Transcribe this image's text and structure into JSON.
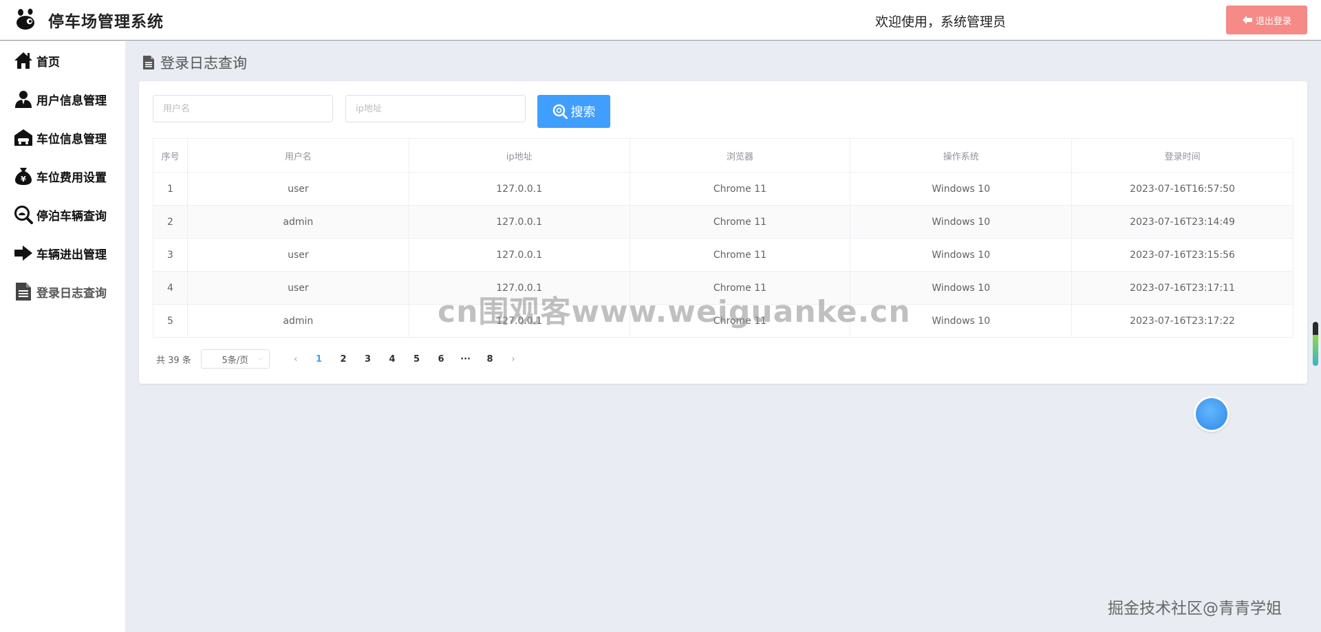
{
  "header": {
    "app_title": "停车场管理系统",
    "welcome_text": "欢迎使用，系统管理员",
    "logout_label": "退出登录"
  },
  "sidebar": {
    "items": [
      {
        "label": "首页",
        "icon": "home-icon"
      },
      {
        "label": "用户信息管理",
        "icon": "user-icon"
      },
      {
        "label": "车位信息管理",
        "icon": "garage-icon"
      },
      {
        "label": "车位费用设置",
        "icon": "money-bag-icon"
      },
      {
        "label": "停泊车辆查询",
        "icon": "search-car-icon"
      },
      {
        "label": "车辆进出管理",
        "icon": "arrow-right-icon"
      },
      {
        "label": "登录日志查询",
        "icon": "document-icon",
        "active": true
      }
    ]
  },
  "main": {
    "page_title": "登录日志查询",
    "search": {
      "username_placeholder": "用户名",
      "ip_placeholder": "ip地址",
      "search_label": "搜索"
    },
    "table": {
      "columns": [
        "序号",
        "用户名",
        "ip地址",
        "浏览器",
        "操作系统",
        "登录时间"
      ],
      "rows": [
        [
          "1",
          "user",
          "127.0.0.1",
          "Chrome 11",
          "Windows 10",
          "2023-07-16T16:57:50"
        ],
        [
          "2",
          "admin",
          "127.0.0.1",
          "Chrome 11",
          "Windows 10",
          "2023-07-16T23:14:49"
        ],
        [
          "3",
          "user",
          "127.0.0.1",
          "Chrome 11",
          "Windows 10",
          "2023-07-16T23:15:56"
        ],
        [
          "4",
          "user",
          "127.0.0.1",
          "Chrome 11",
          "Windows 10",
          "2023-07-16T23:17:11"
        ],
        [
          "5",
          "admin",
          "127.0.0.1",
          "Chrome 11",
          "Windows 10",
          "2023-07-16T23:17:22"
        ]
      ]
    },
    "pagination": {
      "total_text": "共 39 条",
      "page_size": "5条/页",
      "pages": [
        "1",
        "2",
        "3",
        "4",
        "5",
        "6",
        "···",
        "8"
      ],
      "current_page": "1",
      "prev_symbol": "‹",
      "next_symbol": "›"
    }
  },
  "watermarks": {
    "center": "cn围观客www.weiguanke.cn",
    "bottom": "掘金技术社区@青青学姐"
  },
  "colors": {
    "primary": "#409eff",
    "logout": "#f58a87",
    "background": "#e9ecf2"
  }
}
